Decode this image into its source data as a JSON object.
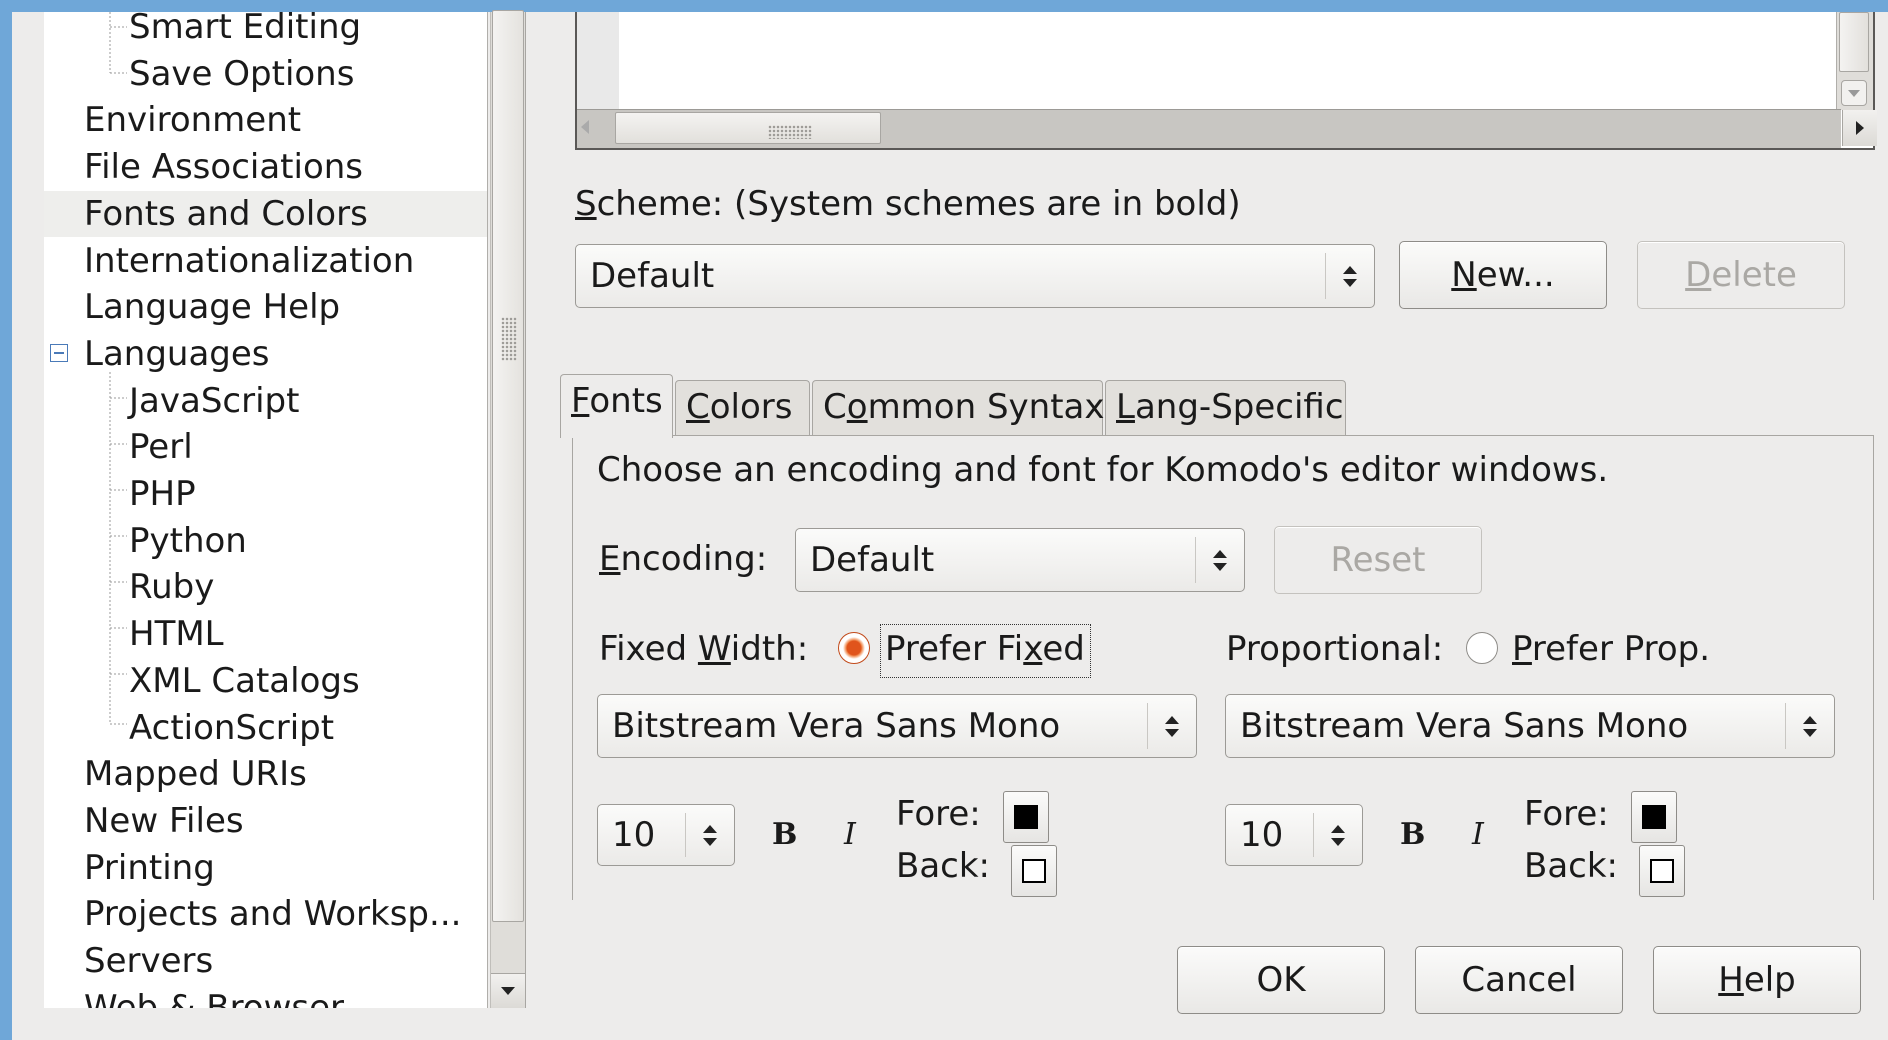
{
  "tree": {
    "items": [
      {
        "label": "Smart Editing",
        "level": 1
      },
      {
        "label": "Save Options",
        "level": 1
      },
      {
        "label": "Environment",
        "level": 0
      },
      {
        "label": "File Associations",
        "level": 0
      },
      {
        "label": "Fonts and Colors",
        "level": 0,
        "selected": true
      },
      {
        "label": "Internationalization",
        "level": 0
      },
      {
        "label": "Language Help",
        "level": 0
      },
      {
        "label": "Languages",
        "level": 0,
        "expanded": true
      },
      {
        "label": "JavaScript",
        "level": 1
      },
      {
        "label": "Perl",
        "level": 1
      },
      {
        "label": "PHP",
        "level": 1
      },
      {
        "label": "Python",
        "level": 1
      },
      {
        "label": "Ruby",
        "level": 1
      },
      {
        "label": "HTML",
        "level": 1
      },
      {
        "label": "XML Catalogs",
        "level": 1
      },
      {
        "label": "ActionScript",
        "level": 1
      },
      {
        "label": "Mapped URIs",
        "level": 0
      },
      {
        "label": "New Files",
        "level": 0
      },
      {
        "label": "Printing",
        "level": 0
      },
      {
        "label": "Projects and Worksp...",
        "level": 0
      },
      {
        "label": "Servers",
        "level": 0
      },
      {
        "label": "Web & Browser",
        "level": 0
      }
    ]
  },
  "scheme": {
    "label_key": "S",
    "label_rest": "cheme: (System schemes are in bold)",
    "value": "Default",
    "new_key": "N",
    "new_rest": "ew...",
    "delete_key": "D",
    "delete_rest": "elete"
  },
  "tabs": [
    {
      "key": "F",
      "rest": "onts",
      "active": true
    },
    {
      "key": "C",
      "rest": "olors"
    },
    {
      "pre": "C",
      "key": "o",
      "rest": "mmon Syntax"
    },
    {
      "key": "L",
      "rest": "ang-Specific"
    }
  ],
  "fonts": {
    "description": "Choose an encoding and font for Komodo's editor windows.",
    "encoding_key": "E",
    "encoding_rest": "ncoding:",
    "encoding_value": "Default",
    "reset_label": "Reset",
    "fixed_pre": "Fixed ",
    "fixed_key": "W",
    "fixed_rest": "idth:",
    "prefer_fixed_pre": "Prefer Fi",
    "prefer_fixed_key": "x",
    "prefer_fixed_rest": "ed",
    "proportional_label": "Proportional:",
    "prefer_prop_key": "P",
    "prefer_prop_rest": "refer Prop.",
    "fixed_font": "Bitstream Vera Sans Mono",
    "prop_font": "Bitstream Vera Sans Mono",
    "fixed_size": "10",
    "prop_size": "10",
    "bold_glyph": "B",
    "italic_glyph": "I",
    "fore_label": "Fore:",
    "back_label": "Back:"
  },
  "footer": {
    "ok_label": "OK",
    "cancel_label": "Cancel",
    "help_key": "H",
    "help_rest": "elp"
  },
  "colors": {
    "selection_bg": "#eeeeec",
    "radio_accent": "#e0541c",
    "desktop_bg": "#6fa7d8"
  }
}
